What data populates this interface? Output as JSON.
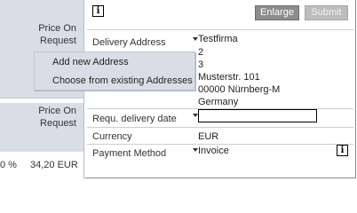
{
  "left_panel": {
    "block1_line1": "Price On",
    "block1_line2": "Request",
    "block2_line1": "Price On",
    "block2_line2": "Request",
    "bottom_pct": "0 %",
    "bottom_amount": "34,20 EUR"
  },
  "toolbar": {
    "info_icon": "info-icon",
    "enlarge_label": "Enlarge",
    "submit_label": "Submit"
  },
  "form": {
    "delivery_address_label": "Delivery Address",
    "address_lines": [
      "Testfirma",
      "2",
      "3",
      "Musterstr. 101",
      "00000 Nürnberg-M",
      "Germany"
    ],
    "requ_delivery_date_label": "Requ. delivery date",
    "requ_delivery_date_value": "",
    "currency_label": "Currency",
    "currency_value": "EUR",
    "payment_method_label": "Payment Method",
    "payment_method_value": "Invoice"
  },
  "context_menu": {
    "items": [
      "Add new Address",
      "Choose from existing Addresses"
    ]
  },
  "colors": {
    "panel_bg": "#d9dee6",
    "button_bg": "#8c8c8c",
    "button_disabled_bg": "#bdbdbd"
  }
}
